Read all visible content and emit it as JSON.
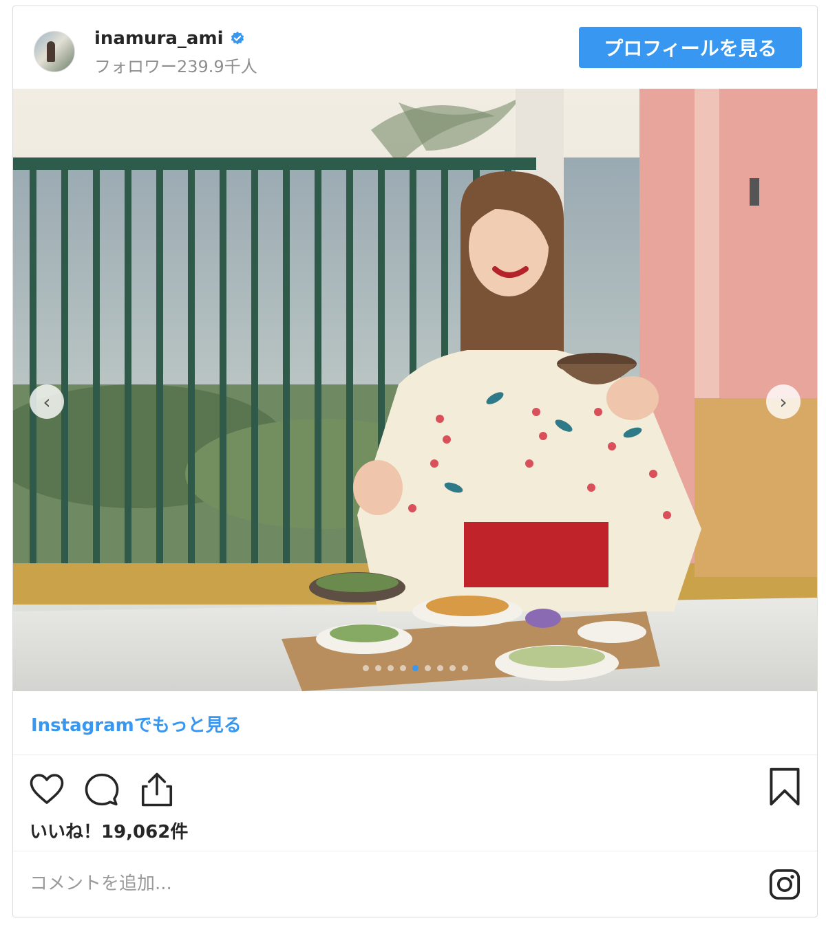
{
  "post": {
    "username": "inamura_ami",
    "followers": "フォロワー239.9千人",
    "profile_button": "プロフィールを見る",
    "more_link": "Instagramでもっと見る",
    "likes": "いいね！19,062件",
    "comment_placeholder": "コメントを追加...",
    "carousel": {
      "dot_count": 9,
      "active_index": 4,
      "prev_icon": "‹",
      "next_icon": "›"
    }
  },
  "icons": {
    "verified": "verified-badge-icon",
    "like": "heart-icon",
    "comment": "comment-bubble-icon",
    "share": "share-upload-icon",
    "save": "bookmark-icon",
    "instagram": "instagram-logo-icon"
  },
  "colors": {
    "accent": "#3897f0",
    "text": "#262626",
    "muted": "#8e8e8e",
    "border": "#dbdbdb"
  }
}
